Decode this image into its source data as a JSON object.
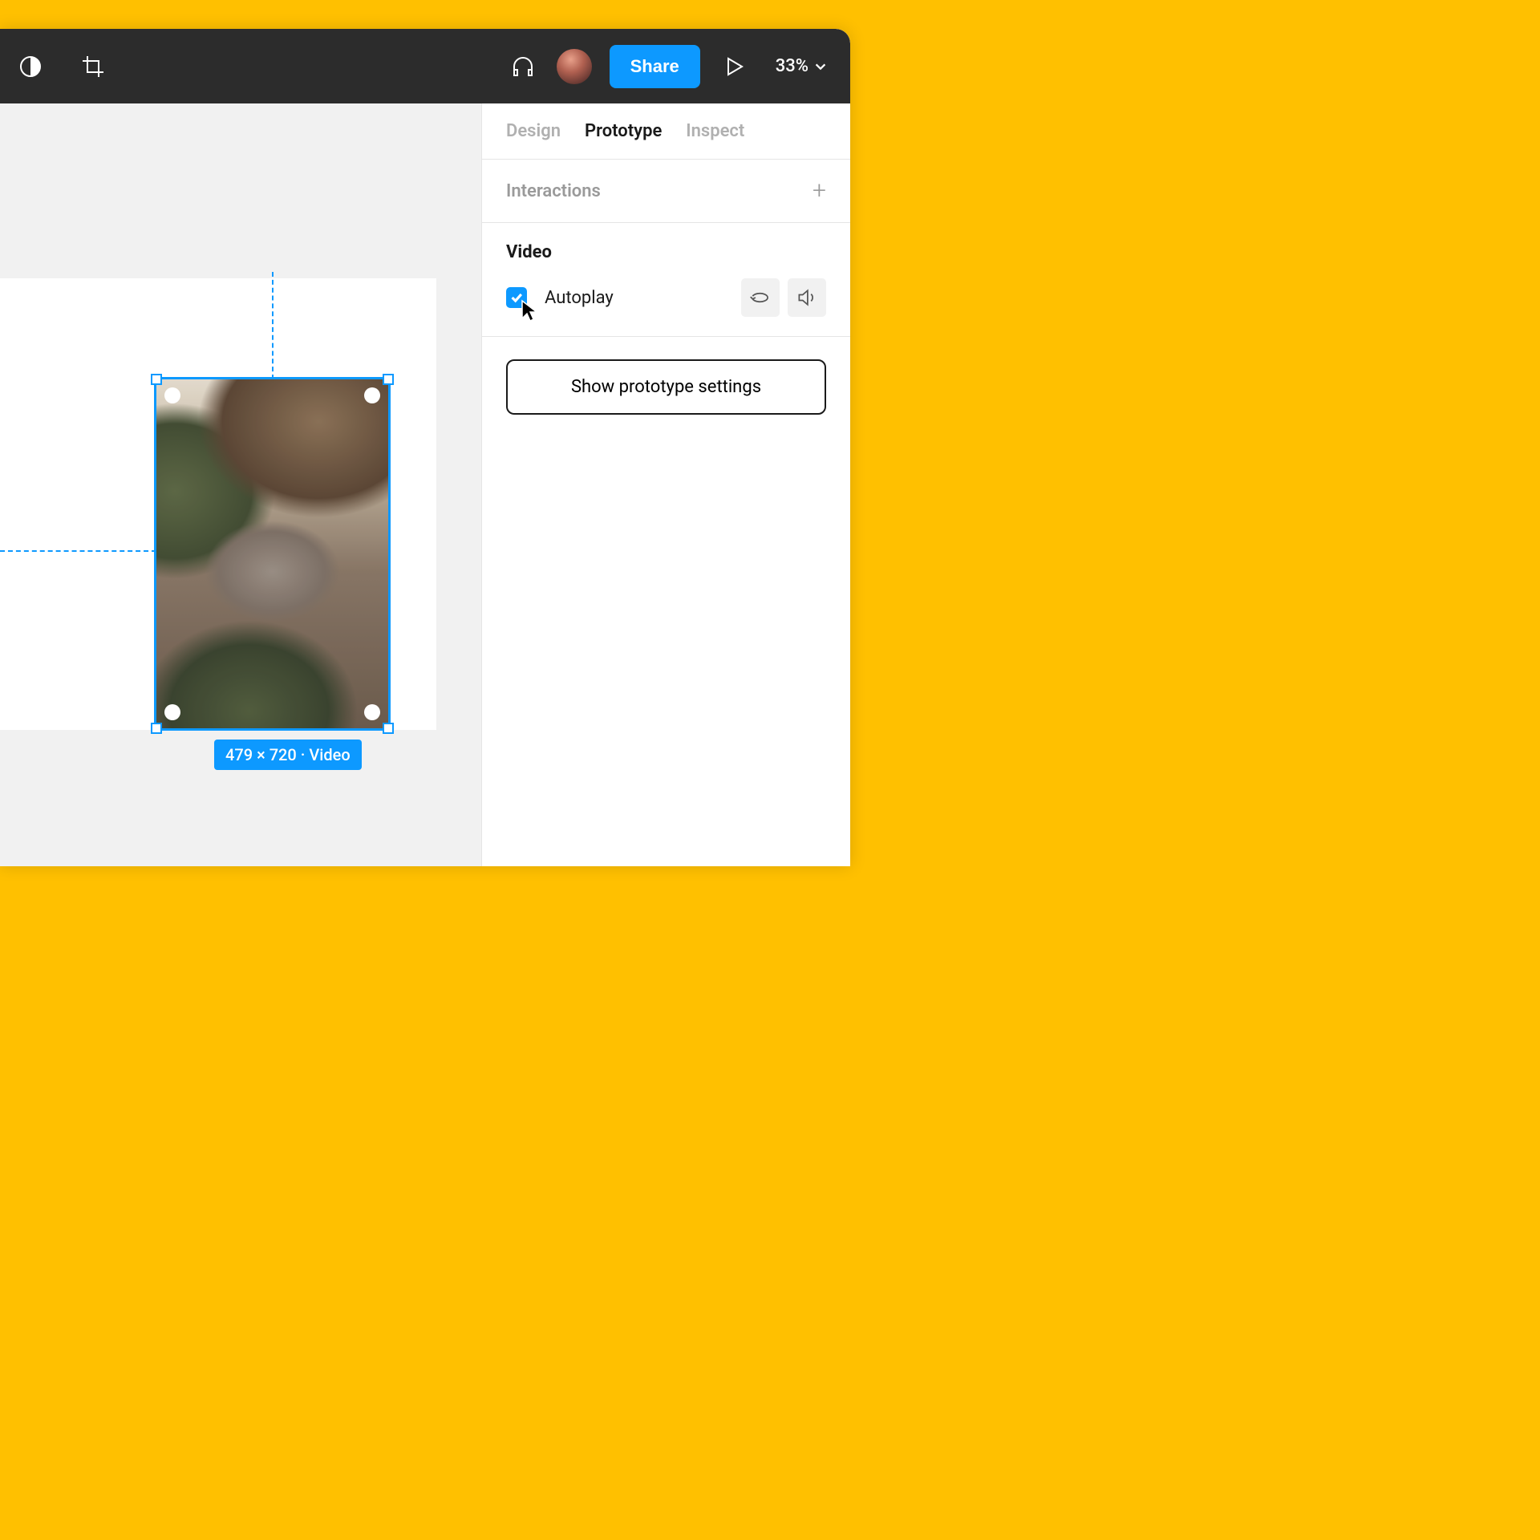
{
  "topbar": {
    "share_label": "Share",
    "zoom_label": "33%"
  },
  "canvas": {
    "selection_badge": "479 × 720 · Video"
  },
  "panel": {
    "tabs": {
      "design": "Design",
      "prototype": "Prototype",
      "inspect": "Inspect"
    },
    "interactions_title": "Interactions",
    "video_title": "Video",
    "autoplay_label": "Autoplay",
    "show_prototype_settings": "Show prototype settings"
  }
}
